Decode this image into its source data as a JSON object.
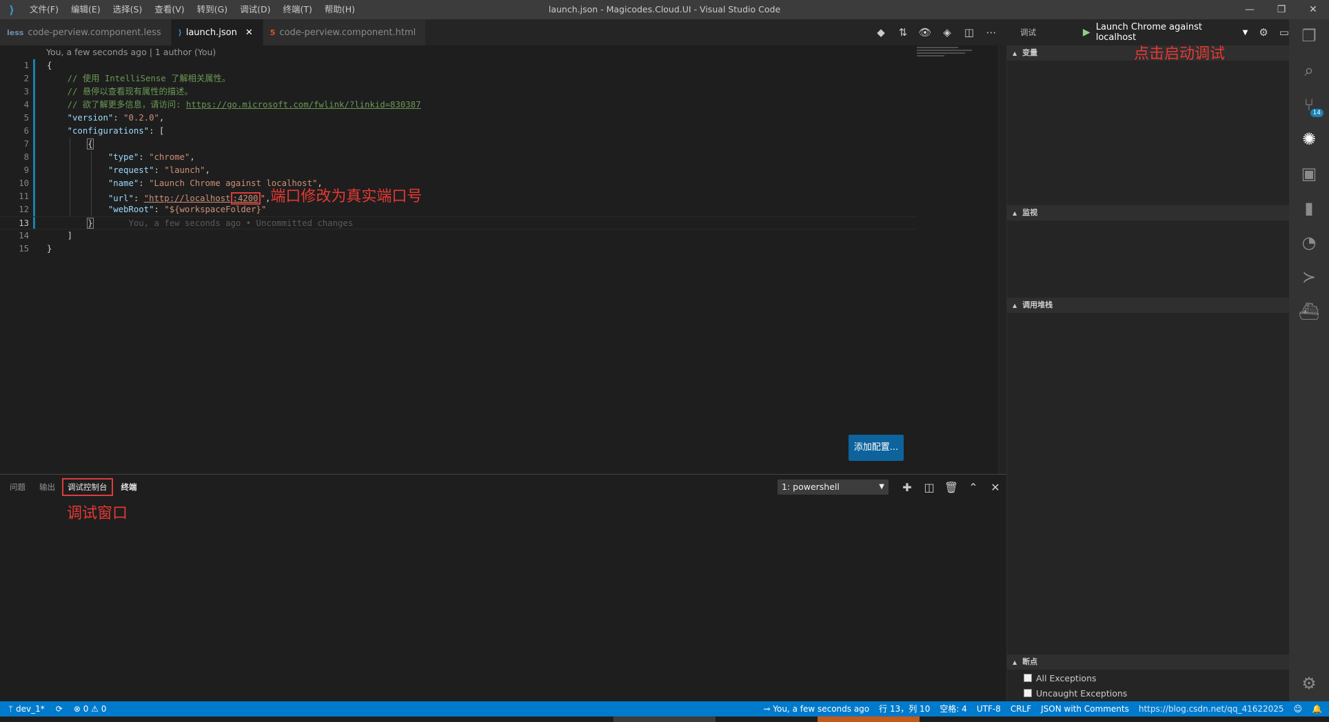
{
  "window": {
    "title": "launch.json - Magicodes.Cloud.UI - Visual Studio Code",
    "menu": [
      "文件(F)",
      "编辑(E)",
      "选择(S)",
      "查看(V)",
      "转到(G)",
      "调试(D)",
      "终端(T)",
      "帮助(H)"
    ]
  },
  "tabs": [
    {
      "label": "code-perview.component.less",
      "icon": "less-file-icon",
      "active": false
    },
    {
      "label": "launch.json",
      "icon": "vscode-json-icon",
      "active": true
    },
    {
      "label": "code-perview.component.html",
      "icon": "html5-file-icon",
      "active": false
    }
  ],
  "debug_header": {
    "title": "调试",
    "config_name": "Launch Chrome against localhost"
  },
  "editor": {
    "blame_header": "You, a few seconds ago | 1 author (You)",
    "line_numbers": [
      "1",
      "2",
      "3",
      "4",
      "5",
      "6",
      "7",
      "8",
      "9",
      "10",
      "11",
      "12",
      "13",
      "14",
      "15"
    ],
    "comment1": "// 使用 IntelliSense 了解相关属性。",
    "comment2": "// 悬停以查看现有属性的描述。",
    "comment3_prefix": "// 欲了解更多信息，请访问: ",
    "comment3_link": "https://go.microsoft.com/fwlink/?linkid=830387",
    "version_key": "\"version\"",
    "version_val": "\"0.2.0\"",
    "configs_key": "\"configurations\"",
    "type_key": "\"type\"",
    "type_val": "\"chrome\"",
    "request_key": "\"request\"",
    "request_val": "\"launch\"",
    "name_key": "\"name\"",
    "name_val": "\"Launch Chrome against localhost\"",
    "url_key": "\"url\"",
    "url_val_prefix": "\"http://localhost",
    "url_port": ":4200",
    "url_val_suffix": "\"",
    "webroot_key": "\"webRoot\"",
    "webroot_val": "\"${workspaceFolder}\"",
    "ghost_blame": "You, a few seconds ago • Uncommitted changes",
    "annotation_port": "端口修改为真实端口号",
    "add_config_button": "添加配置..."
  },
  "panel": {
    "tabs": [
      "问题",
      "输出",
      "调试控制台",
      "终端"
    ],
    "active_tab": "终端",
    "terminal_select": "1: powershell",
    "annotation": "调试窗口"
  },
  "debug_views": {
    "variables": "变量",
    "watch": "监视",
    "callstack": "调用堆栈",
    "breakpoints": "断点",
    "breakpoint_items": [
      "All Exceptions",
      "Uncaught Exceptions"
    ],
    "annotation": "点击启动调试"
  },
  "activity_bar": {
    "scm_badge": "14"
  },
  "statusbar": {
    "branch": "dev_1*",
    "errors": "0",
    "warnings": "0",
    "blame": "You, a few seconds ago",
    "cursor": "行 13，列 10",
    "spaces": "空格: 4",
    "encoding": "UTF-8",
    "eol": "CRLF",
    "language": "JSON with Comments",
    "watermark": "https://blog.csdn.net/qq_41622025"
  },
  "colors": {
    "accent": "#007acc",
    "annotation_red": "#e53935",
    "button_blue": "#0e639c"
  }
}
